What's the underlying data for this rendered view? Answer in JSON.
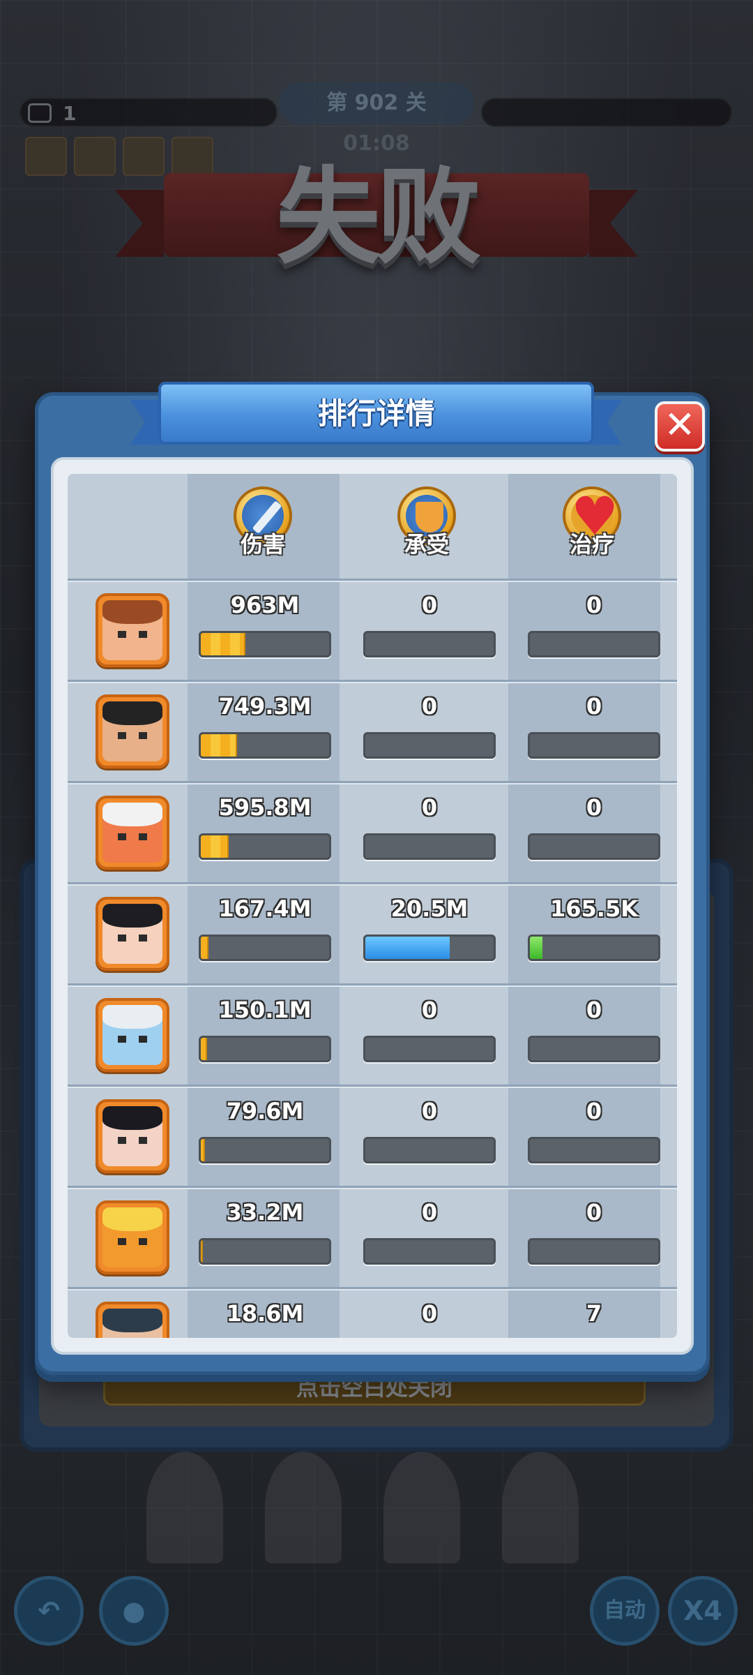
{
  "background": {
    "level_text": "1",
    "stage_text": "第 902 关",
    "timer_text": "01:08",
    "defeat_title": "失败",
    "close_hint": "点击空白处关闭",
    "auto_label": "自动",
    "speed_label": "X4"
  },
  "modal": {
    "title": "排行详情",
    "close_symbol": "✕",
    "headers": [
      {
        "label": "伤害",
        "icon": "sword-icon"
      },
      {
        "label": "承受",
        "icon": "shield-icon"
      },
      {
        "label": "治疗",
        "icon": "heart-icon"
      }
    ],
    "rows": [
      {
        "hero": "hero-curly-hair-boy",
        "damage": "963M",
        "taken": "0",
        "healing": "0",
        "damage_frac": 0.35,
        "taken_frac": 0,
        "healing_frac": 0
      },
      {
        "hero": "hero-long-hair-warrior",
        "damage": "749.3M",
        "taken": "0",
        "healing": "0",
        "damage_frac": 0.28,
        "taken_frac": 0,
        "healing_frac": 0
      },
      {
        "hero": "hero-red-ogre",
        "damage": "595.8M",
        "taken": "0",
        "healing": "0",
        "damage_frac": 0.22,
        "taken_frac": 0,
        "healing_frac": 0
      },
      {
        "hero": "hero-dark-hair-lady",
        "damage": "167.4M",
        "taken": "20.5M",
        "healing": "165.5K",
        "damage_frac": 0.06,
        "taken_frac": 0.66,
        "healing_frac": 0.1
      },
      {
        "hero": "hero-blue-elder",
        "damage": "150.1M",
        "taken": "0",
        "healing": "0",
        "damage_frac": 0.05,
        "taken_frac": 0,
        "healing_frac": 0
      },
      {
        "hero": "hero-purple-eyed-lady",
        "damage": "79.6M",
        "taken": "0",
        "healing": "0",
        "damage_frac": 0.03,
        "taken_frac": 0,
        "healing_frac": 0
      },
      {
        "hero": "hero-golden-emblem",
        "damage": "33.2M",
        "taken": "0",
        "healing": "0",
        "damage_frac": 0.015,
        "taken_frac": 0,
        "healing_frac": 0
      },
      {
        "hero": "hero-green-eyed-girl",
        "damage": "18.6M",
        "taken": "0",
        "healing": "7",
        "damage_frac": 0.01,
        "taken_frac": 0,
        "healing_frac": 0
      }
    ]
  },
  "colors": {
    "damage_bar": "#f4b01e",
    "taken_bar": "#2b8ee6",
    "healing_bar": "#3db82a",
    "close_button": "#cf2d26",
    "title_ribbon": "#4a90dd"
  }
}
